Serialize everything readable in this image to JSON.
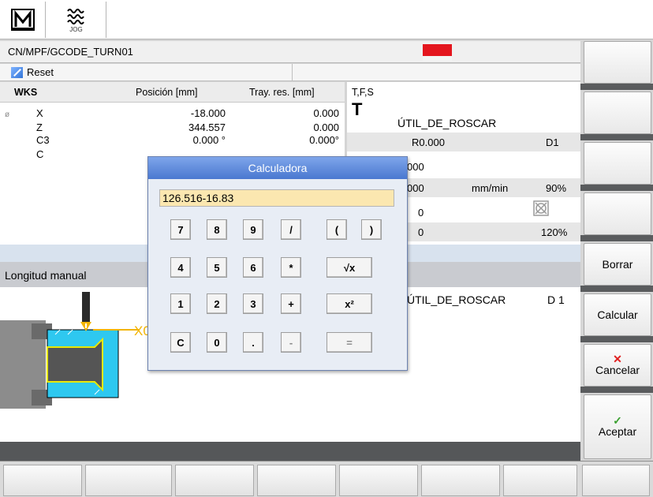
{
  "toolbar": {
    "jog_label": "JOG"
  },
  "header": {
    "program_path": "CN/MPF/GCODE_TURN01",
    "status": "Reset"
  },
  "wks": {
    "headers": [
      "WKS",
      "Posición [mm]",
      "Tray. res. [mm]"
    ],
    "rows": [
      {
        "axis": "X",
        "pos": "-18.000",
        "res": "0.000"
      },
      {
        "axis": "Z",
        "pos": "344.557",
        "res": "0.000"
      },
      {
        "axis": "C3",
        "pos": "0.000 °",
        "res": "0.000°"
      },
      {
        "axis": "C",
        "pos": "",
        "res": ""
      }
    ]
  },
  "tfs": {
    "header": "T,F,S",
    "t_letter": "T",
    "tool_name": "ÚTIL_DE_ROSCAR",
    "radius": "R0.000",
    "d_value": "D1",
    "f_value1": "000",
    "f_value2": "000",
    "f_unit": "mm/min",
    "f_override": "90%",
    "s_value1": "0",
    "s_value2": "0",
    "s_override": "120%"
  },
  "manual_length": {
    "title": "Longitud manual",
    "tool_name": "ÚTIL_DE_ROSCAR",
    "d_label": "D 1",
    "axis_label": "X0"
  },
  "calculator": {
    "title": "Calculadora",
    "input_value": "126.516-16.83",
    "rows": [
      [
        "7",
        "8",
        "9",
        "/",
        "(",
        ")"
      ],
      [
        "4",
        "5",
        "6",
        "*",
        "√x"
      ],
      [
        "1",
        "2",
        "3",
        "+",
        "x²"
      ],
      [
        "C",
        "0",
        ".",
        "-",
        "="
      ]
    ]
  },
  "softkeys": {
    "borrar": "Borrar",
    "calcular": "Calcular",
    "cancelar": "Cancelar",
    "aceptar": "Aceptar"
  },
  "colors": {
    "cancel_mark": "#e02020",
    "accept_mark": "#3aa030",
    "accent": "#4a78d0",
    "logo_red": "#e4161e"
  }
}
